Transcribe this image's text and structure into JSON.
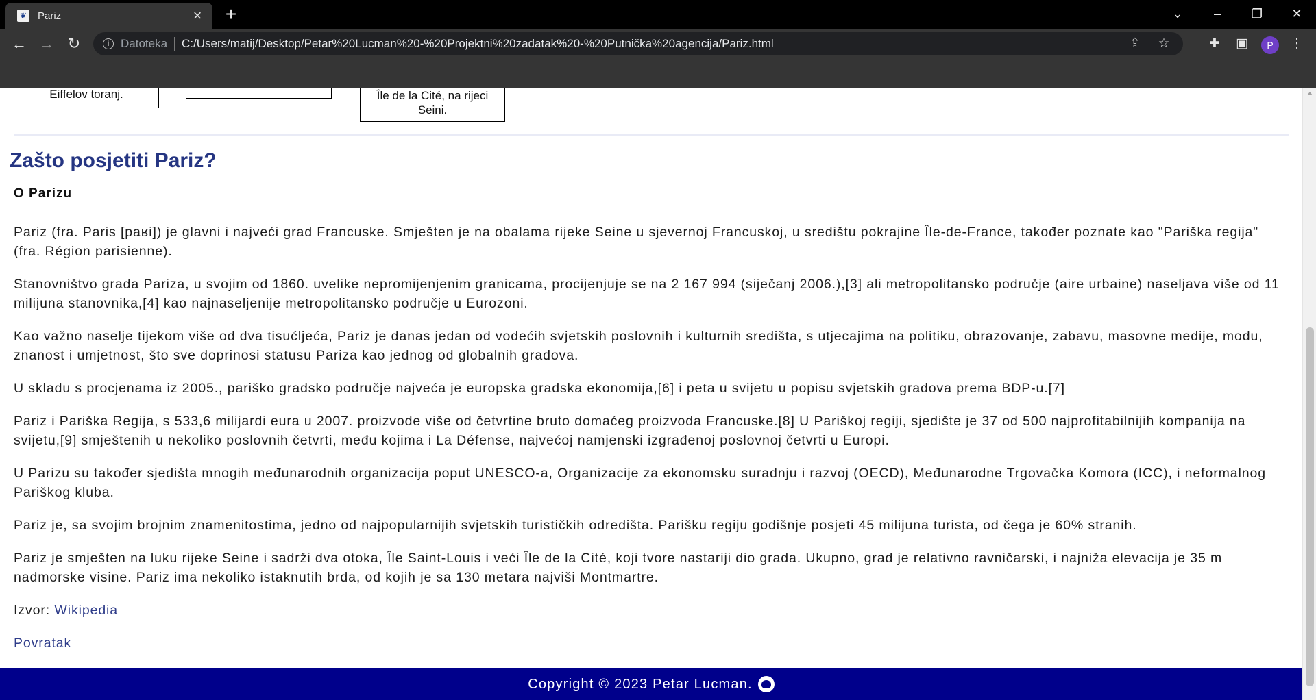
{
  "browser": {
    "tab_title": "Pariz",
    "favicon_glyph": "❦",
    "scheme_label": "Datoteka",
    "url": "C:/Users/matij/Desktop/Petar%20Lucman%20-%20Projektni%20zadatak%20-%20Putnička%20agencija/Pariz.html",
    "profile_initial": "P"
  },
  "captions": [
    {
      "text": "Eiffelov toranj."
    },
    {
      "text": ""
    },
    {
      "text": "Île de la Cité, na rijeci Seini."
    }
  ],
  "main": {
    "title": "Zašto posjetiti Pariz?",
    "subtitle": "O Parizu",
    "paragraphs": [
      "Pariz (fra. Paris [paʁi]) je glavni i najveći grad Francuske. Smješten je na obalama rijeke Seine u sjevernoj Francuskoj, u središtu pokrajine Île-de-France, također poznate kao \"Pariška regija\" (fra. Région parisienne).",
      "Stanovništvo grada Pariza, u svojim od 1860. uvelike nepromijenjenim granicama, procijenjuje se na 2 167 994 (siječanj 2006.),[3] ali metropolitansko područje (aire urbaine) naseljava više od 11 milijuna stanovnika,[4] kao najnaseljenije metropolitansko područje u Eurozoni.",
      "Kao važno naselje tijekom više od dva tisućljeća, Pariz je danas jedan od vodećih svjetskih poslovnih i kulturnih središta, s utjecajima na politiku, obrazovanje, zabavu, masovne medije, modu, znanost i umjetnost, što sve doprinosi statusu Pariza kao jednog od globalnih gradova.",
      "U skladu s procjenama iz 2005., pariško gradsko područje najveća je europska gradska ekonomija,[6] i peta u svijetu u popisu svjetskih gradova prema BDP-u.[7]",
      "Pariz i Pariška Regija, s 533,6 milijardi eura u 2007. proizvode više od četvrtine bruto domaćeg proizvoda Francuske.[8] U Pariškoj regiji, sjedište je 37 od 500 najprofitabilnijih kompanija na svijetu,[9] smještenih u nekoliko poslovnih četvrti, među kojima i La Défense, najvećoj namjenski izgrađenoj poslovnoj četvrti u Europi.",
      "U Parizu su također sjedišta mnogih međunarodnih organizacija poput UNESCO-a, Organizacije za ekonomsku suradnju i razvoj (OECD), Međunarodne Trgovačka Komora (ICC), i neformalnog Pariškog kluba.",
      "Pariz je, sa svojim brojnim znamenitostima, jedno od najpopularnijih svjetskih turističkih odredišta. Parišku regiju godišnje posjeti 45 milijuna turista, od čega je 60% stranih.",
      "Pariz je smješten na luku rijeke Seine i sadrži dva otoka, Île Saint-Louis i veći Île de la Cité, koji tvore nastariji dio grada. Ukupno, grad je relativno ravničarski, i najniža elevacija je 35 m nadmorske visine. Pariz ima nekoliko istaknutih brda, od kojih je sa 130 metara najviši Montmartre."
    ],
    "source_label": "Izvor:",
    "source_link": "Wikipedia",
    "back_link": "Povratak"
  },
  "footer": {
    "copyright": "Copyright © 2023 Petar Lucman."
  },
  "icons": {
    "back": "arrow-left-icon",
    "forward": "arrow-right-icon",
    "reload": "reload-icon",
    "info": "info-icon",
    "share": "share-icon",
    "bookmark": "star-icon",
    "extensions": "puzzle-icon",
    "sidepanel": "side-panel-icon",
    "menu": "kebab-menu-icon",
    "github": "github-icon"
  },
  "colors": {
    "heading": "#253582",
    "link": "#2f3d8a",
    "footer_bg": "#00008b"
  }
}
